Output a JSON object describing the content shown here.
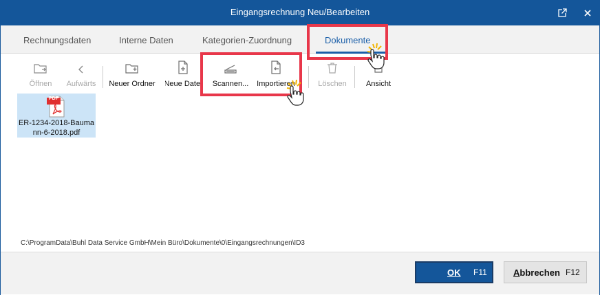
{
  "window": {
    "title": "Eingangsrechnung Neu/Bearbeiten"
  },
  "tabs": [
    {
      "label": "Rechnungsdaten",
      "active": false
    },
    {
      "label": "Interne Daten",
      "active": false
    },
    {
      "label": "Kategorien-Zuordnung",
      "active": false
    },
    {
      "label": "Dokumente",
      "active": true
    }
  ],
  "toolbar": {
    "open": "Öffnen",
    "up": "Aufwärts",
    "new_folder": "Neuer Ordner",
    "new_file": "Neue Datei",
    "scan": "Scannen...",
    "import": "Importieren",
    "delete": "Löschen",
    "view": "Ansicht"
  },
  "files": [
    {
      "badge": "PDF",
      "name": "ER-1234-2018-Baumann-6-2018.pdf",
      "name_line1": "ER-1234-2018-Bauma",
      "name_line2": "nn-6-2018.pdf"
    }
  ],
  "path": "C:\\ProgramData\\Buhl Data Service GmbH\\Mein Büro\\Dokumente\\0\\Eingangsrechnungen\\ID3",
  "buttons": {
    "ok_label": "OK",
    "ok_key": "F11",
    "cancel_label": "Abbrechen",
    "cancel_key": "F12"
  },
  "colors": {
    "titlebar": "#14569a",
    "accent": "#1a5ea8",
    "highlight": "#e8374a",
    "selection": "#cce4f7",
    "pdf": "#e03030"
  },
  "icons": [
    "popout-icon",
    "close-icon",
    "folder-open-icon",
    "chevron-left-icon",
    "folder-plus-icon",
    "file-plus-icon",
    "scanner-icon",
    "file-import-icon",
    "trash-icon",
    "view-icon",
    "pdf-file-icon",
    "hand-cursor-icon"
  ]
}
